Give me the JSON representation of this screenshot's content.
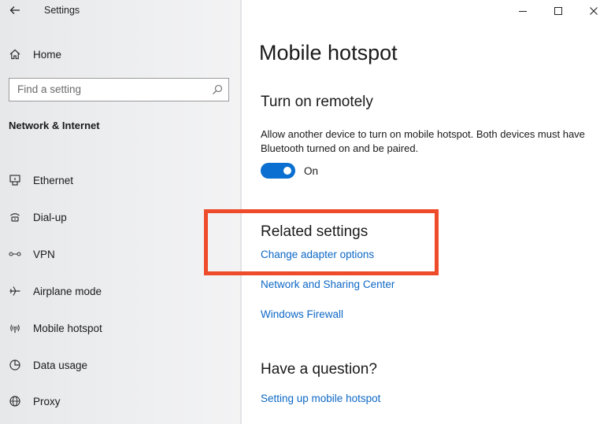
{
  "app": {
    "title": "Settings"
  },
  "sidebar": {
    "home_label": "Home",
    "search_placeholder": "Find a setting",
    "section_title": "Network & Internet",
    "items": [
      {
        "label": "Ethernet",
        "icon": "ethernet-icon"
      },
      {
        "label": "Dial-up",
        "icon": "dialup-icon"
      },
      {
        "label": "VPN",
        "icon": "vpn-icon"
      },
      {
        "label": "Airplane mode",
        "icon": "airplane-icon"
      },
      {
        "label": "Mobile hotspot",
        "icon": "hotspot-icon"
      },
      {
        "label": "Data usage",
        "icon": "data-usage-icon"
      },
      {
        "label": "Proxy",
        "icon": "proxy-icon"
      }
    ]
  },
  "main": {
    "title": "Mobile hotspot",
    "remote": {
      "heading": "Turn on remotely",
      "description": "Allow another device to turn on mobile hotspot. Both devices must have Bluetooth turned on and be paired.",
      "toggle_state": "On"
    },
    "related": {
      "heading": "Related settings",
      "links": [
        "Change adapter options",
        "Network and Sharing Center",
        "Windows Firewall"
      ]
    },
    "question": {
      "heading": "Have a question?",
      "links": [
        "Setting up mobile hotspot"
      ]
    }
  },
  "colors": {
    "accent": "#0a6fd1",
    "link": "#0d68c5",
    "highlight": "#ee4b2a",
    "sidebar_bg": "#eeeff1"
  }
}
